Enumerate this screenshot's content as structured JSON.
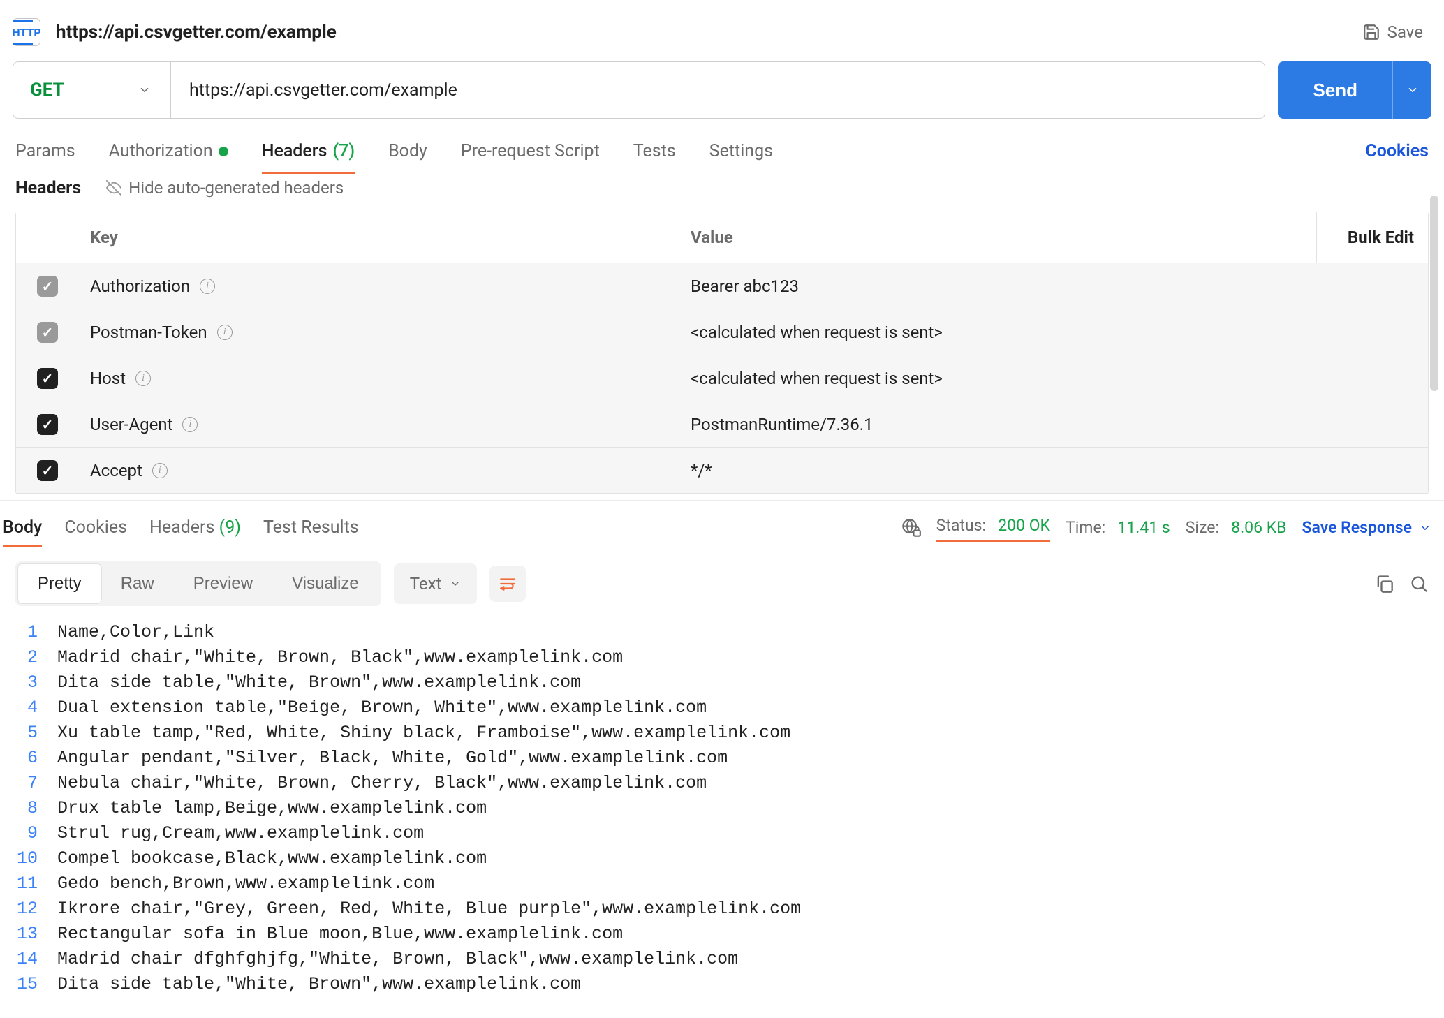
{
  "title": "https://api.csvgetter.com/example",
  "save_label": "Save",
  "method": "GET",
  "url": "https://api.csvgetter.com/example",
  "send_label": "Send",
  "tabs": {
    "params": "Params",
    "auth": "Authorization",
    "headers": "Headers",
    "headers_count": "(7)",
    "body": "Body",
    "prereq": "Pre-request Script",
    "tests": "Tests",
    "settings": "Settings"
  },
  "cookies_link": "Cookies",
  "headers_section": {
    "title": "Headers",
    "hide_auto": "Hide auto-generated headers",
    "key_header": "Key",
    "value_header": "Value",
    "bulk_edit": "Bulk Edit",
    "rows": [
      {
        "key": "Authorization",
        "value": "Bearer abc123",
        "dimmed": true
      },
      {
        "key": "Postman-Token",
        "value": "<calculated when request is sent>",
        "dimmed": true
      },
      {
        "key": "Host",
        "value": "<calculated when request is sent>",
        "dimmed": false
      },
      {
        "key": "User-Agent",
        "value": "PostmanRuntime/7.36.1",
        "dimmed": false
      },
      {
        "key": "Accept",
        "value": "*/*",
        "dimmed": false
      }
    ]
  },
  "response_tabs": {
    "body": "Body",
    "cookies": "Cookies",
    "headers": "Headers",
    "headers_count": "(9)",
    "tests": "Test Results"
  },
  "status": {
    "status_label": "Status:",
    "status_value": "200 OK",
    "time_label": "Time:",
    "time_value": "11.41 s",
    "size_label": "Size:",
    "size_value": "8.06 KB"
  },
  "save_response_label": "Save Response",
  "view": {
    "pretty": "Pretty",
    "raw": "Raw",
    "preview": "Preview",
    "visualize": "Visualize",
    "format": "Text"
  },
  "response_body": [
    "Name,Color,Link",
    "Madrid chair,\"White, Brown, Black\",www.examplelink.com",
    "Dita side table,\"White, Brown\",www.examplelink.com",
    "Dual extension table,\"Beige, Brown, White\",www.examplelink.com",
    "Xu table tamp,\"Red, White, Shiny black, Framboise\",www.examplelink.com",
    "Angular pendant,\"Silver, Black, White, Gold\",www.examplelink.com",
    "Nebula chair,\"White, Brown, Cherry, Black\",www.examplelink.com",
    "Drux table lamp,Beige,www.examplelink.com",
    "Strul rug,Cream,www.examplelink.com",
    "Compel bookcase,Black,www.examplelink.com",
    "Gedo bench,Brown,www.examplelink.com",
    "Ikrore chair,\"Grey, Green, Red, White, Blue purple\",www.examplelink.com",
    "Rectangular sofa in Blue moon,Blue,www.examplelink.com",
    "Madrid chair dfghfghjfg,\"White, Brown, Black\",www.examplelink.com",
    "Dita side table,\"White, Brown\",www.examplelink.com"
  ]
}
